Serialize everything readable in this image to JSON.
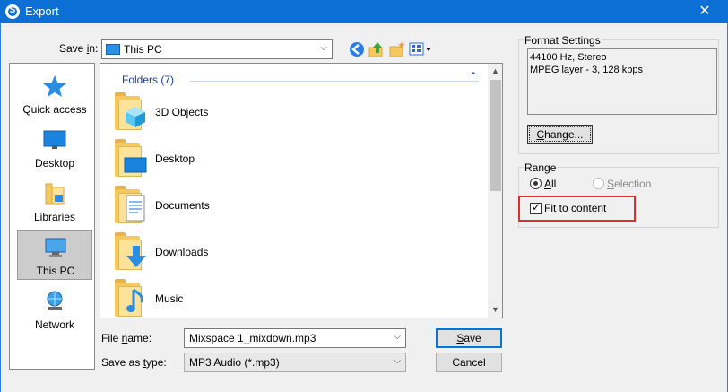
{
  "window": {
    "app_icon_letter": "S",
    "title": "Export",
    "close_glyph": "✕"
  },
  "save_in": {
    "label": "Save in:",
    "value": "This PC",
    "icons": [
      "back-icon",
      "up-folder-icon",
      "new-folder-icon",
      "view-menu-icon"
    ]
  },
  "places": [
    {
      "label": "Quick access",
      "icon": "star-icon"
    },
    {
      "label": "Desktop",
      "icon": "desktop-icon"
    },
    {
      "label": "Libraries",
      "icon": "libraries-icon"
    },
    {
      "label": "This PC",
      "icon": "computer-icon",
      "selected": true
    },
    {
      "label": "Network",
      "icon": "network-icon"
    }
  ],
  "file_list": {
    "group_header": "Folders (7)",
    "items": [
      {
        "label": "3D Objects",
        "icon": "3d-objects-folder-icon"
      },
      {
        "label": "Desktop",
        "icon": "desktop-folder-icon"
      },
      {
        "label": "Documents",
        "icon": "documents-folder-icon"
      },
      {
        "label": "Downloads",
        "icon": "downloads-folder-icon"
      },
      {
        "label": "Music",
        "icon": "music-folder-icon"
      }
    ]
  },
  "file_name": {
    "label": "File name:",
    "value": "Mixspace 1_mixdown.mp3"
  },
  "save_as_type": {
    "label": "Save as type:",
    "value": "MP3 Audio (*.mp3)"
  },
  "buttons": {
    "save": "Save",
    "cancel": "Cancel"
  },
  "format_settings": {
    "title": "Format Settings",
    "line1": "44100 Hz, Stereo",
    "line2": "MPEG layer - 3, 128 kbps",
    "change_button": "Change..."
  },
  "range": {
    "title": "Range",
    "all_label": "All",
    "selection_label": "Selection",
    "selected": "All"
  },
  "fit_to_content": {
    "label": "Fit to content",
    "checked": true
  },
  "colors": {
    "titlebar": "#0b6fd6",
    "highlight": "#d93030",
    "link_blue": "#1e3e9a"
  }
}
